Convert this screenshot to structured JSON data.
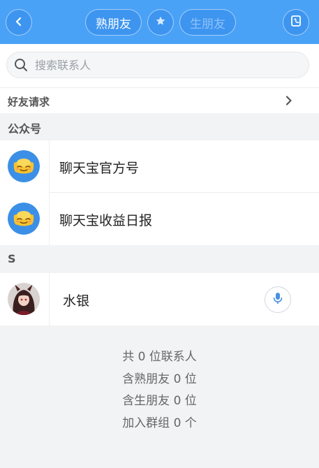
{
  "header": {
    "tab_close_friends": "熟朋友",
    "tab_strangers": "生朋友",
    "back_icon": "chevron-left-icon",
    "star_icon": "star-icon",
    "contacts_icon": "contacts-book-icon",
    "colors": {
      "bar": "#4aa2f7",
      "button": "#3d95f0",
      "inactive_text": "#8fc1f7"
    }
  },
  "search": {
    "placeholder": "搜索联系人",
    "value": ""
  },
  "friend_requests": {
    "label": "好友请求"
  },
  "sections": {
    "official": {
      "label": "公众号",
      "items": [
        {
          "name": "聊天宝官方号",
          "avatar": "gold-ingot-face-icon"
        },
        {
          "name": "聊天宝收益日报",
          "avatar": "gold-ingot-face-icon"
        }
      ]
    },
    "s": {
      "label": "S",
      "items": [
        {
          "name": "水银",
          "avatar": "anime-girl-avatar",
          "action_icon": "microphone-icon"
        }
      ]
    }
  },
  "stats": {
    "total": "共 0 位联系人",
    "close": "含熟朋友 0 位",
    "strangers": "含生朋友 0 位",
    "groups": "加入群组 0 个"
  }
}
